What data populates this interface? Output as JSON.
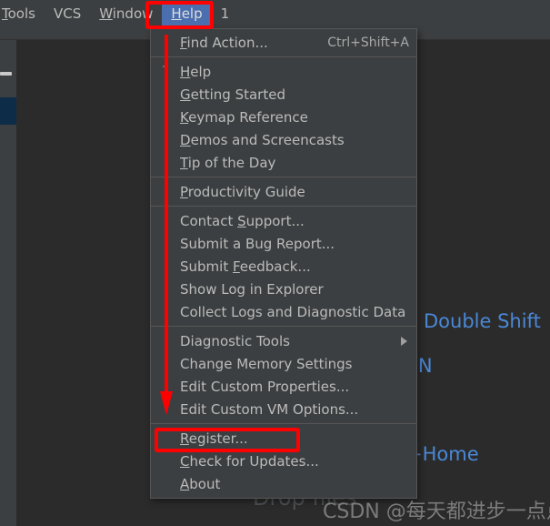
{
  "window": {
    "background_color": "#2b2b2b",
    "panel_color": "#3c3f41",
    "accent_color": "#4b6eaf",
    "annotation_color": "#ff0000",
    "hint_color": "#4a88d6"
  },
  "menubar": {
    "items": [
      {
        "label": "Tools",
        "mnemonic": "T",
        "active": false
      },
      {
        "label": "VCS",
        "mnemonic": "",
        "active": false
      },
      {
        "label": "Window",
        "mnemonic": "W",
        "active": false
      },
      {
        "label": "Help",
        "mnemonic": "H",
        "active": true
      }
    ],
    "trailing_text": "1"
  },
  "menu": {
    "name": "help-menu",
    "groups": [
      {
        "items": [
          {
            "label": "Find Action...",
            "mnemonic": "F",
            "accel": "Ctrl+Shift+A",
            "icon": "",
            "submenu": false
          }
        ]
      },
      {
        "items": [
          {
            "label": "Help",
            "mnemonic": "H",
            "accel": "",
            "icon": "?",
            "submenu": false
          },
          {
            "label": "Getting Started",
            "mnemonic": "G",
            "accel": "",
            "icon": "",
            "submenu": false
          },
          {
            "label": "Keymap Reference",
            "mnemonic": "K",
            "accel": "",
            "icon": "",
            "submenu": false
          },
          {
            "label": "Demos and Screencasts",
            "mnemonic": "D",
            "accel": "",
            "icon": "",
            "submenu": false
          },
          {
            "label": "Tip of the Day",
            "mnemonic": "T",
            "accel": "",
            "icon": "",
            "submenu": false
          }
        ]
      },
      {
        "items": [
          {
            "label": "Productivity Guide",
            "mnemonic": "P",
            "accel": "",
            "icon": "",
            "submenu": false
          }
        ]
      },
      {
        "items": [
          {
            "label": "Contact Support...",
            "mnemonic": "S",
            "accel": "",
            "icon": "",
            "submenu": false
          },
          {
            "label": "Submit a Bug Report...",
            "mnemonic": "",
            "accel": "",
            "icon": "",
            "submenu": false
          },
          {
            "label": "Submit Feedback...",
            "mnemonic": "F",
            "accel": "",
            "icon": "",
            "submenu": false
          },
          {
            "label": "Show Log in Explorer",
            "mnemonic": "",
            "accel": "",
            "icon": "",
            "submenu": false
          },
          {
            "label": "Collect Logs and Diagnostic Data",
            "mnemonic": "",
            "accel": "",
            "icon": "",
            "submenu": false
          }
        ]
      },
      {
        "items": [
          {
            "label": "Diagnostic Tools",
            "mnemonic": "",
            "accel": "",
            "icon": "",
            "submenu": true
          },
          {
            "label": "Change Memory Settings",
            "mnemonic": "",
            "accel": "",
            "icon": "",
            "submenu": false
          },
          {
            "label": "Edit Custom Properties...",
            "mnemonic": "",
            "accel": "",
            "icon": "",
            "submenu": false
          },
          {
            "label": "Edit Custom VM Options...",
            "mnemonic": "",
            "accel": "",
            "icon": "",
            "submenu": false
          }
        ]
      },
      {
        "items": [
          {
            "label": "Register...",
            "mnemonic": "R",
            "accel": "",
            "icon": "",
            "submenu": false,
            "highlighted": true
          },
          {
            "label": "Check for Updates...",
            "mnemonic": "C",
            "accel": "",
            "icon": "",
            "submenu": false
          },
          {
            "label": "About",
            "mnemonic": "A",
            "accel": "",
            "icon": "",
            "submenu": false
          }
        ]
      }
    ]
  },
  "editor_hints": {
    "search_everywhere": "Double Shift",
    "go_to_file": "t+N",
    "recent_files": "+Home",
    "drop_files": "Drop files"
  },
  "watermark": {
    "text": "CSDN @每天都进步一点点"
  }
}
